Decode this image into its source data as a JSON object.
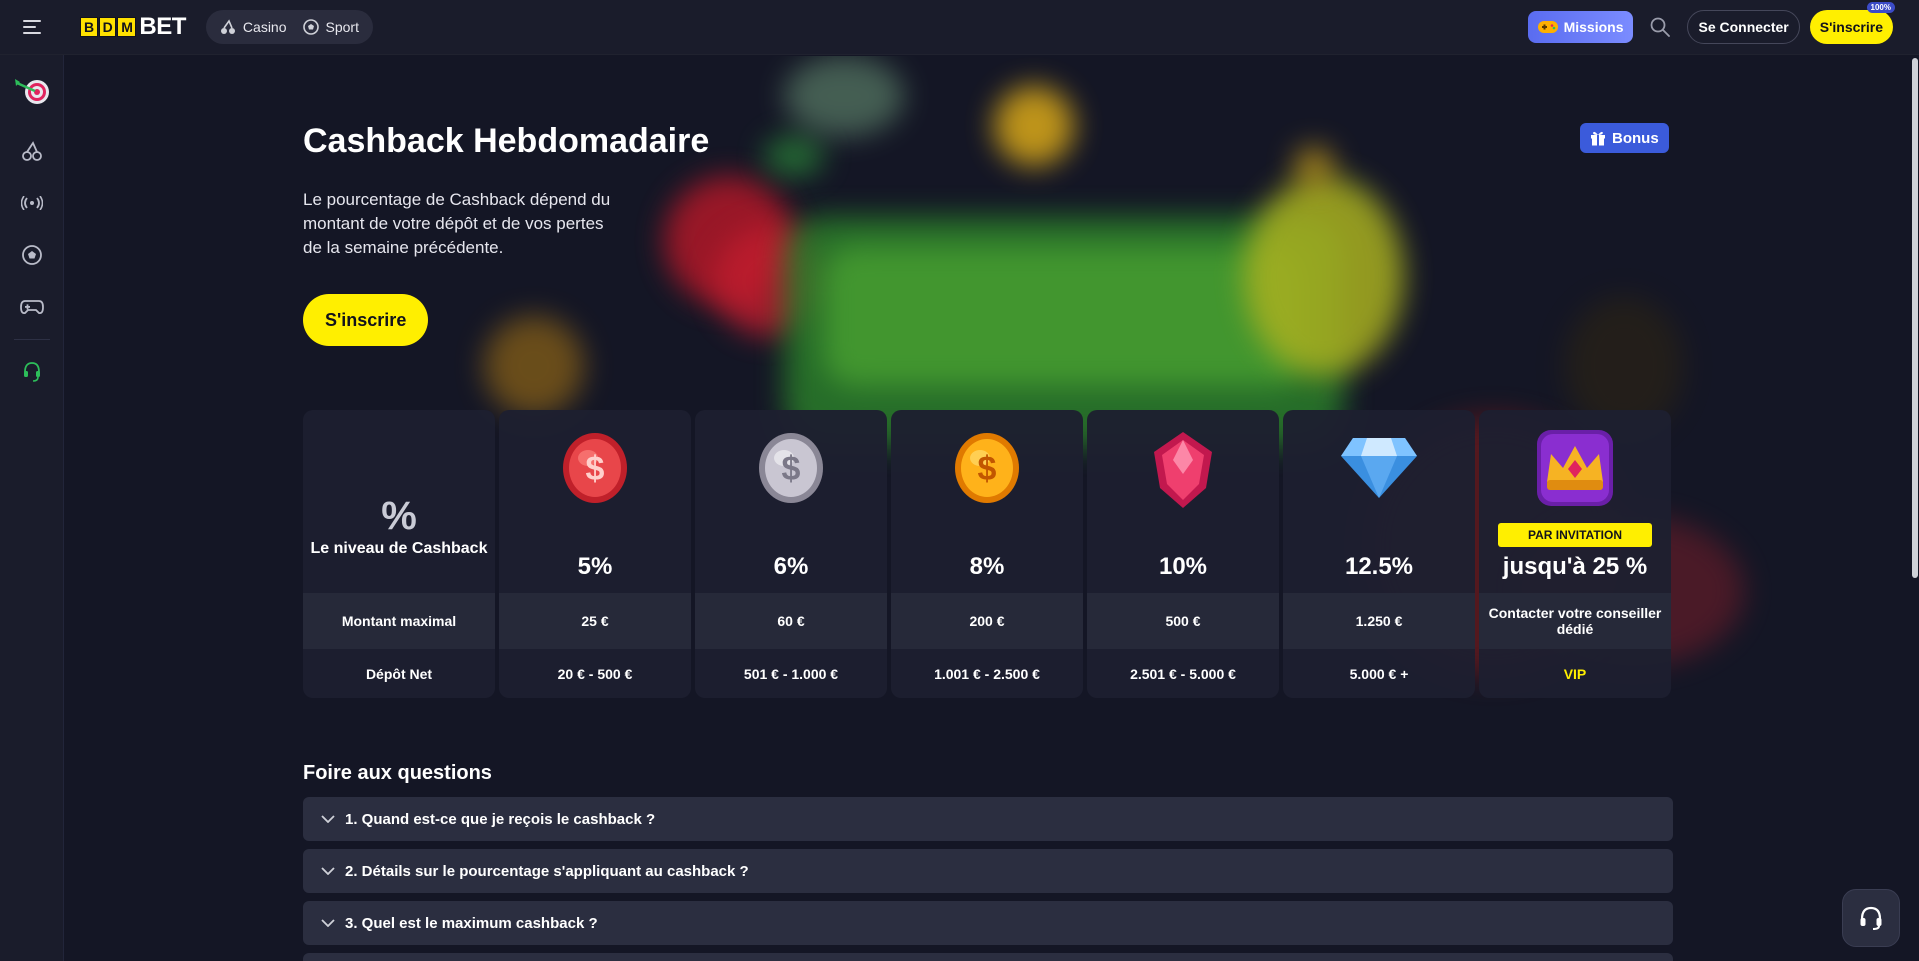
{
  "header": {
    "logo": {
      "box1": "B",
      "box2": "D",
      "box3": "M",
      "text": "BET"
    },
    "nav": [
      {
        "label": "Casino",
        "icon": "casino-icon"
      },
      {
        "label": "Sport",
        "icon": "soccer-ball-icon"
      }
    ],
    "missions_label": "Missions",
    "login_label": "Se Connecter",
    "signup_label": "S'inscrire",
    "signup_badge": "100%"
  },
  "sidebar": {
    "items": [
      {
        "name": "darts-icon"
      },
      {
        "name": "cherries-icon"
      },
      {
        "name": "live-broadcast-icon"
      },
      {
        "name": "soccer-ball-icon"
      },
      {
        "name": "gamepad-icon"
      },
      {
        "name": "support-agent-icon"
      }
    ]
  },
  "hero": {
    "title": "Cashback Hebdomadaire",
    "description": "Le pourcentage de Cashback dépend du montant de votre dépôt et de vos pertes de la semaine précédente.",
    "cta": "S'inscrire",
    "bonus_label": "Bonus"
  },
  "tiers": {
    "label_column": {
      "symbol": "%",
      "title": "Le niveau de Cashback",
      "max_label": "Montant maximal",
      "deposit_label": "Dépôt Net"
    },
    "levels": [
      {
        "icon": "red-coin-icon",
        "pct": "5%",
        "max": "25 €",
        "deposit": "20 € - 500 €"
      },
      {
        "icon": "silver-coin-icon",
        "pct": "6%",
        "max": "60 €",
        "deposit": "501 € - 1.000 €"
      },
      {
        "icon": "gold-coin-icon",
        "pct": "8%",
        "max": "200 €",
        "deposit": "1.001 € - 2.500 €"
      },
      {
        "icon": "ruby-gem-icon",
        "pct": "10%",
        "max": "500 €",
        "deposit": "2.501 € - 5.000 €"
      },
      {
        "icon": "diamond-icon",
        "pct": "12.5%",
        "max": "1.250 €",
        "deposit": "5.000 € +"
      },
      {
        "icon": "crown-icon",
        "pct": "jusqu'à 25 %",
        "badge": "PAR INVITATION",
        "max": "Contacter votre conseiller dédié",
        "deposit": "VIP"
      }
    ]
  },
  "faq": {
    "title": "Foire aux questions",
    "items": [
      "1. Quand est-ce que je reçois le cashback ?",
      "2. Détails sur le pourcentage s'appliquant au cashback ?",
      "3. Quel est le maximum cashback ?"
    ]
  },
  "colors": {
    "accent_yellow": "#ffef00",
    "bg": "#141625",
    "panel": "#1d1f30",
    "missions_blue": "#5a6cf0",
    "bonus_blue": "#3b5bdb"
  }
}
